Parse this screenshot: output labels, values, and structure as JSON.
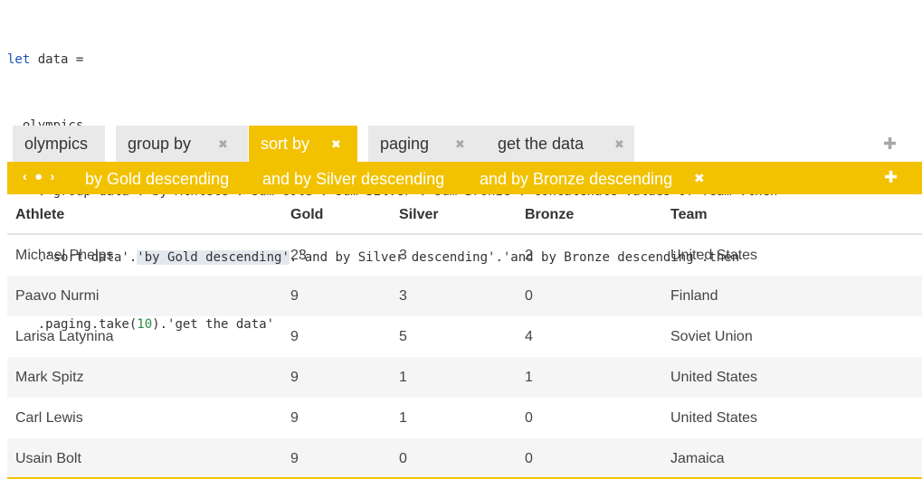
{
  "code": {
    "line1": {
      "keyword": "let",
      "rest": " data ="
    },
    "line2": "  olympics",
    "line3": "    .'group data'.'by Athlete'.'sum Gold'.'sum Silver'.'sum Bronze'.'concatenate values of Team'.then",
    "line4": {
      "before": "    .'sort data'.",
      "highlight": "'by Gold descending'",
      "after": ".'and by Silver descending'.'and by Bronze descending'.then"
    },
    "line5": {
      "before": "    .paging.take(",
      "number": "10",
      "after": ").'get the data'"
    }
  },
  "tabs": [
    {
      "label": "olympics",
      "closable": false,
      "active": false
    },
    {
      "label": "group by",
      "closable": true,
      "active": false
    },
    {
      "label": "sort by",
      "closable": true,
      "active": true
    },
    {
      "label": "paging",
      "closable": true,
      "active": false
    },
    {
      "label": "get the data",
      "closable": true,
      "active": false
    }
  ],
  "tab_close_glyph": "✖",
  "tab_add_glyph": "✚",
  "sortbar": {
    "nav_glyph": "‹ ● ›",
    "criteria": [
      "by Gold descending",
      "and by Silver descending",
      "and by Bronze descending"
    ],
    "remove_glyph": "✖",
    "add_glyph": "✚"
  },
  "table": {
    "columns": [
      "Athlete",
      "Gold",
      "Silver",
      "Bronze",
      "Team"
    ],
    "rows": [
      [
        "Michael Phelps",
        "23",
        "3",
        "2",
        "United States"
      ],
      [
        "Paavo Nurmi",
        "9",
        "3",
        "0",
        "Finland"
      ],
      [
        "Larisa Latynina",
        "9",
        "5",
        "4",
        "Soviet Union"
      ],
      [
        "Mark Spitz",
        "9",
        "1",
        "1",
        "United States"
      ],
      [
        "Carl Lewis",
        "9",
        "1",
        "0",
        "United States"
      ],
      [
        "Usain Bolt",
        "9",
        "0",
        "0",
        "Jamaica"
      ]
    ]
  },
  "colors": {
    "accent": "#f2c200",
    "keyword": "#1a4fc0",
    "number": "#2c8a3e",
    "highlight": "#e3e8ef"
  }
}
